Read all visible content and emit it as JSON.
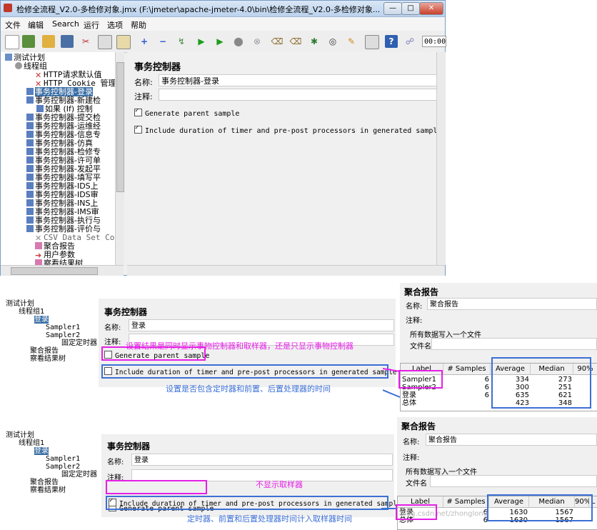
{
  "window": {
    "title": "检修全流程_V2.0-多检修对象.jmx (F:\\jmeter\\apache-jmeter-4.0\\bin\\检修全流程_V2.0-多检修对象...",
    "min": "—",
    "max": "□",
    "close": "✕"
  },
  "menu": [
    "文件",
    "编辑",
    "Search",
    "运行",
    "选项",
    "帮助"
  ],
  "toolbar_time": "00:00",
  "tree": [
    "测试计划",
    "线程组",
    "HTTP请求默认值",
    "HTTP Cookie 管理",
    "事务控制器-登录",
    "事务控制器-新建检",
    "如果 (If) 控制",
    "事务控制器-提交检",
    "事务控制器-运维经",
    "事务控制器-信息专",
    "事务控制器-仿真",
    "事务控制器-检修专",
    "事务控制器-许可单",
    "事务控制器-发起平",
    "事务控制器-填写平",
    "事务控制器-IDS上",
    "事务控制器-IDS审",
    "事务控制器-INS上",
    "事务控制器-IMS审",
    "事务控制器-执行与",
    "事务控制器-评价与",
    "CSV Data Set Con",
    "聚合报告",
    "用户参数",
    "察看结果树"
  ],
  "panel": {
    "heading": "事务控制器",
    "name_label": "名称:",
    "name_value": "事务控制器-登录",
    "comment_label": "注释:",
    "opt1": "Generate parent sample",
    "opt2": "Include duration of timer and pre-post processors in generated sample"
  },
  "demo": {
    "tree": [
      "测试计划",
      "线程组1",
      "登录",
      "Sampler1",
      "Sampler2",
      "固定定时器",
      "聚合报告",
      "察看结果树"
    ],
    "tc_heading": "事务控制器",
    "name_label": "名称:",
    "name_value": "登录",
    "comment_label": "注释:",
    "report_heading": "聚合报告",
    "report_name_value": "聚合报告",
    "write_all": "所有数据写入一个文件",
    "filename_label": "文件名",
    "columns": [
      "Label",
      "# Samples",
      "Average",
      "Median",
      "90%"
    ]
  },
  "demo1": {
    "anno_top": "设置结果是同时显示事物控制器和取样器，还是只显示事物控制器",
    "anno_bottom": "设置是否包含定时器和前置、后置处理器的时间",
    "rows": [
      {
        "label": "Sampler1",
        "samples": "6",
        "avg": "334",
        "median": "273"
      },
      {
        "label": "Sampler2",
        "samples": "6",
        "avg": "300",
        "median": "251"
      },
      {
        "label": "登录",
        "samples": "6",
        "avg": "635",
        "median": "621"
      },
      {
        "label": "总体",
        "samples": "",
        "avg": "423",
        "median": "348"
      }
    ]
  },
  "demo2": {
    "anno_top": "不显示取样器",
    "anno_bottom": "定时器、前置和后置处理器时间计入取样器时间",
    "columns_extra": "L",
    "rows": [
      {
        "label": "登录",
        "samples": "6",
        "avg": "1630",
        "median": "1567"
      },
      {
        "label": "总体",
        "samples": "6",
        "avg": "1630",
        "median": "1567"
      }
    ],
    "watermark": "blog.csdn.net/zhonglong"
  }
}
